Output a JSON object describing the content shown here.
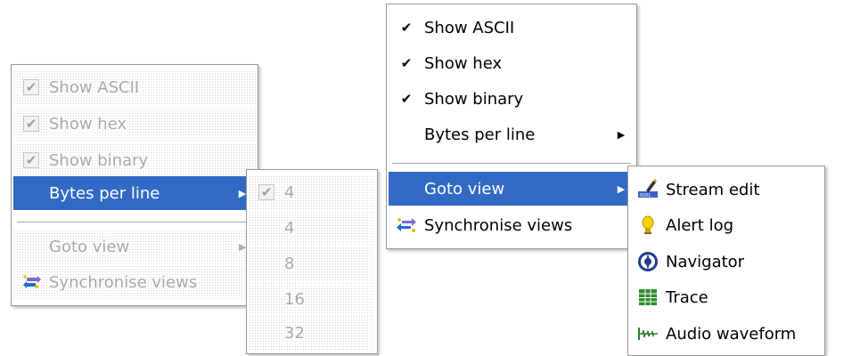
{
  "left_menu": {
    "items": [
      {
        "label": "Show ASCII",
        "checked": true,
        "disabled": true
      },
      {
        "label": "Show hex",
        "checked": true,
        "disabled": true
      },
      {
        "label": "Show binary",
        "checked": true,
        "disabled": true
      },
      {
        "label": "Bytes per line",
        "highlighted": true,
        "has_submenu": true
      },
      {
        "label": "Goto view",
        "disabled": true,
        "has_submenu": true
      },
      {
        "label": "Synchronise views",
        "icon": "sync-icon",
        "disabled": true
      }
    ],
    "arrow_glyph": "▶"
  },
  "bytes_submenu": {
    "items": [
      {
        "label": "4",
        "checked": true
      },
      {
        "label": "4"
      },
      {
        "label": "8"
      },
      {
        "label": "16"
      },
      {
        "label": "32"
      }
    ]
  },
  "right_menu": {
    "items": [
      {
        "label": "Show ASCII",
        "checked": true
      },
      {
        "label": "Show hex",
        "checked": true
      },
      {
        "label": "Show binary",
        "checked": true
      },
      {
        "label": "Bytes per line",
        "has_submenu": true
      },
      {
        "label": "Goto view",
        "highlighted": true,
        "has_submenu": true
      },
      {
        "label": "Synchronise views",
        "icon": "sync-icon"
      }
    ],
    "arrow_glyph": "▶"
  },
  "goto_submenu": {
    "items": [
      {
        "label": "Stream edit",
        "icon": "stream-edit-icon"
      },
      {
        "label": "Alert log",
        "icon": "alert-log-icon"
      },
      {
        "label": "Navigator",
        "icon": "navigator-icon"
      },
      {
        "label": "Trace",
        "icon": "trace-icon"
      },
      {
        "label": "Audio waveform",
        "icon": "audio-waveform-icon"
      }
    ]
  },
  "check_glyph": "✔",
  "colors": {
    "highlight": "#316ac5",
    "menu_border": "#9a9a9a",
    "disabled_text": "#a9a9a9"
  }
}
